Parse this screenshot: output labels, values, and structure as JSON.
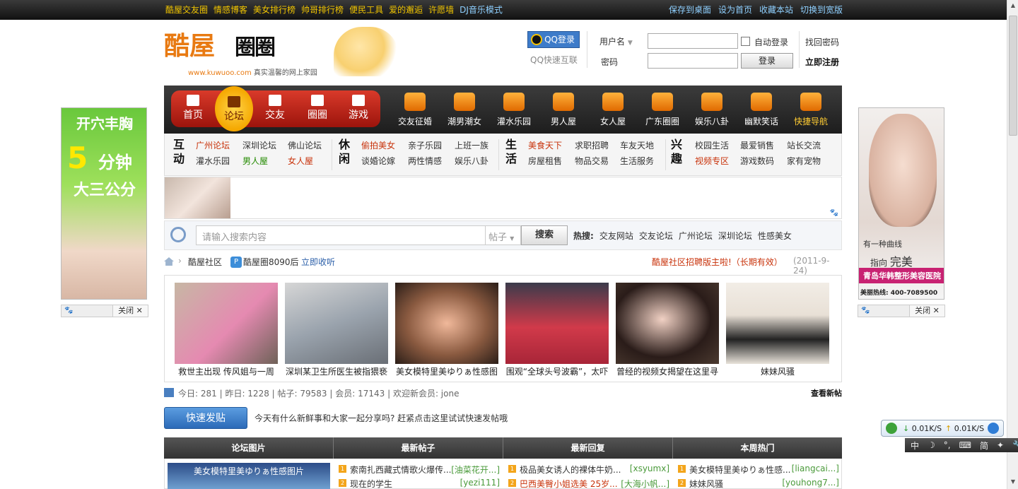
{
  "topbar": {
    "left_links": [
      "酷屋交友圈",
      "情感博客",
      "美女排行榜",
      "帅哥排行榜",
      "便民工具",
      "爱的邂逅",
      "许愿墙",
      "DJ音乐模式"
    ],
    "right_links": [
      "保存到桌面",
      "设为首页",
      "收藏本站",
      "切换到宽版"
    ]
  },
  "logo": {
    "mark": "酷屋",
    "mark2": "圈圈",
    "url": "www.kuwuoo.com",
    "slogan": "真实温馨的网上家园"
  },
  "login": {
    "qq_button": "QQ登录",
    "qq_fast": "QQ快速互联",
    "username_label": "用户名",
    "password_label": "密码",
    "auto_login": "自动登录",
    "login_button": "登录",
    "find_password": "找回密码",
    "register": "立即注册"
  },
  "main_nav": [
    {
      "label": "首页"
    },
    {
      "label": "论坛"
    },
    {
      "label": "交友"
    },
    {
      "label": "圈圈"
    },
    {
      "label": "游戏"
    }
  ],
  "sub_nav": [
    {
      "label": "交友征婚"
    },
    {
      "label": "潮男潮女"
    },
    {
      "label": "灌水乐园"
    },
    {
      "label": "男人屋"
    },
    {
      "label": "女人屋"
    },
    {
      "label": "广东圈圈"
    },
    {
      "label": "娱乐八卦"
    },
    {
      "label": "幽默笑话"
    },
    {
      "label": "快捷导航"
    }
  ],
  "categories": {
    "hudong": {
      "title": "互动",
      "links": [
        "广州论坛",
        "深圳论坛",
        "佛山论坛",
        "灌水乐园",
        "男人屋",
        "女人屋"
      ]
    },
    "xiuxian": {
      "title": "休闲",
      "links": [
        "偷拍美女",
        "亲子乐园",
        "上班一族",
        "谈婚论嫁",
        "两性情感",
        "娱乐八卦"
      ]
    },
    "shenghuo": {
      "title": "生活",
      "links": [
        "美食天下",
        "求职招聘",
        "车友天地",
        "房屋租售",
        "物品交易",
        "生活服务"
      ]
    },
    "xingqu": {
      "title": "兴趣",
      "links": [
        "校园生活",
        "最爱销售",
        "站长交流",
        "视频专区",
        "游戏数码",
        "家有宠物"
      ]
    }
  },
  "search": {
    "placeholder": "请输入搜索内容",
    "type": "帖子",
    "button": "搜索",
    "hot_label": "热搜:",
    "hot": [
      "交友网站",
      "交友论坛",
      "广州论坛",
      "深圳论坛",
      "性感美女"
    ]
  },
  "breadcrumb": {
    "items": [
      "酷屋社区",
      "酷屋圈8090后"
    ],
    "collect": "立即收听",
    "notice": "酷屋社区招聘版主啦!（长期有效）",
    "date": "(2011-9-24)"
  },
  "photos": [
    {
      "caption": "救世主出现 传风姐与一周"
    },
    {
      "caption": "深圳某卫生所医生被指猥亵"
    },
    {
      "caption": "美女模特里美ゆりぁ性感图"
    },
    {
      "caption": "围观“全球头号波霸”，太吓"
    },
    {
      "caption": "曾经的视频女揭望在这里寻"
    },
    {
      "caption": "妹妹风骚"
    }
  ],
  "stats": {
    "today": "今日: 281",
    "yesterday": "昨日: 1228",
    "posts": "帖子: 79583",
    "members": "会员: 17143",
    "welcome": "欢迎新会员: jone",
    "newest": "查看新帖"
  },
  "quick_post": {
    "button": "快速发贴",
    "text": "今天有什么新鲜事和大家一起分享吗? 赶紧点击这里试试快速发帖哦"
  },
  "tabs": [
    "论坛图片",
    "最新帖子",
    "最新回复",
    "本周热门"
  ],
  "panels": {
    "pic_caption": "美女模特里美ゆりぁ性感图片",
    "latest_posts": [
      {
        "title": "索南扎西藏式情歌火爆传...",
        "author": "[油菜花开...]"
      },
      {
        "title": "现在的学生",
        "author": "[yezi111]"
      }
    ],
    "latest_replies": [
      {
        "title": "极品美女诱人的裸体牛奶...",
        "author": "[xsyumx]"
      },
      {
        "title": "巴西美臀小姐选美 25岁...",
        "author": "[大海小帆...]"
      }
    ],
    "weekly_hot": [
      {
        "title": "美女模特里美ゆりぁ性感...",
        "author": "[liangcai...]"
      },
      {
        "title": "妹妹风骚",
        "author": "[youhong7...]"
      }
    ]
  },
  "ads": {
    "left": {
      "l1": "开穴丰胸",
      "l2_num": "5",
      "l2_txt": "分钟",
      "l3": "大三公分",
      "close": "关闭"
    },
    "right": {
      "l1": "有一种曲线",
      "l2": "指向",
      "l2b": "完美",
      "l3": "青岛华韩整形美容医院",
      "l4": "美丽热线: 400-7089500",
      "close": "关闭"
    }
  },
  "netmon": {
    "down": "0.01K/S",
    "up": "0.01K/S"
  },
  "ime": [
    "中",
    "☽",
    "°,",
    "⌨",
    "简",
    "✦",
    "🔧"
  ]
}
